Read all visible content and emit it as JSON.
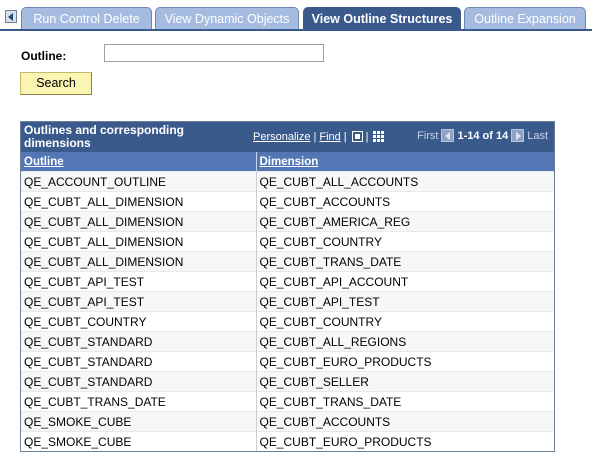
{
  "tabs": [
    {
      "label": "Run Control Delete",
      "active": false
    },
    {
      "label": "View Dynamic Objects",
      "active": false
    },
    {
      "label": "View Outline Structures",
      "active": true
    },
    {
      "label": "Outline Expansion",
      "active": false
    }
  ],
  "search": {
    "outline_label": "Outline:",
    "outline_value": "",
    "button_label": "Search"
  },
  "grid": {
    "title": "Outlines and corresponding dimensions",
    "personalize": "Personalize",
    "find": "Find",
    "first": "First",
    "count": "1-14 of 14",
    "last": "Last",
    "columns": [
      "Outline",
      "Dimension"
    ],
    "rows": [
      [
        "QE_ACCOUNT_OUTLINE",
        "QE_CUBT_ALL_ACCOUNTS"
      ],
      [
        "QE_CUBT_ALL_DIMENSION",
        "QE_CUBT_ACCOUNTS"
      ],
      [
        "QE_CUBT_ALL_DIMENSION",
        "QE_CUBT_AMERICA_REG"
      ],
      [
        "QE_CUBT_ALL_DIMENSION",
        "QE_CUBT_COUNTRY"
      ],
      [
        "QE_CUBT_ALL_DIMENSION",
        "QE_CUBT_TRANS_DATE"
      ],
      [
        "QE_CUBT_API_TEST",
        "QE_CUBT_API_ACCOUNT"
      ],
      [
        "QE_CUBT_API_TEST",
        "QE_CUBT_API_TEST"
      ],
      [
        "QE_CUBT_COUNTRY",
        "QE_CUBT_COUNTRY"
      ],
      [
        "QE_CUBT_STANDARD",
        "QE_CUBT_ALL_REGIONS"
      ],
      [
        "QE_CUBT_STANDARD",
        "QE_CUBT_EURO_PRODUCTS"
      ],
      [
        "QE_CUBT_STANDARD",
        "QE_CUBT_SELLER"
      ],
      [
        "QE_CUBT_TRANS_DATE",
        "QE_CUBT_TRANS_DATE"
      ],
      [
        "QE_SMOKE_CUBE",
        "QE_CUBT_ACCOUNTS"
      ],
      [
        "QE_SMOKE_CUBE",
        "QE_CUBT_EURO_PRODUCTS"
      ]
    ]
  },
  "colors": {
    "tab_inactive": "#a5bce0",
    "tab_active": "#3b5a8c",
    "grid_header": "#3b5a8c",
    "column_header": "#5377b5",
    "search_button": "#fbf5b4"
  },
  "icons": {
    "tab_scroll": "triangle-left-icon",
    "zoom": "view-all-icon",
    "download": "download-grid-icon",
    "prev": "arrow-left-icon",
    "next": "arrow-right-icon"
  }
}
